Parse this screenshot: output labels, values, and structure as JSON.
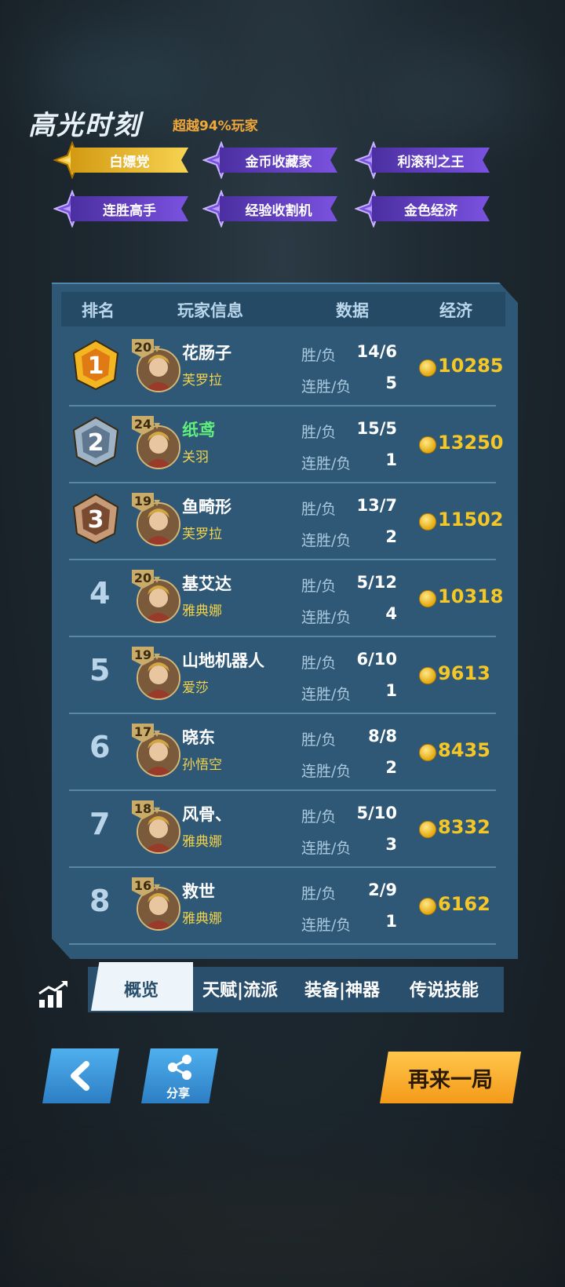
{
  "header": {
    "title": "高光时刻",
    "subtitle": "超越94%玩家"
  },
  "badges": [
    "白嫖党",
    "金币收藏家",
    "利滚利之王",
    "连胜高手",
    "经验收割机",
    "金色经济"
  ],
  "table": {
    "columns": [
      "排名",
      "玩家信息",
      "数据",
      "经济"
    ],
    "win_loss_label": "胜/负",
    "streak_label": "连胜/负",
    "rows": [
      {
        "rank": "1",
        "level": "20",
        "name": "花肠子",
        "hero": "芙罗拉",
        "win_loss": "14/6",
        "streak": "5",
        "gold": "10285"
      },
      {
        "rank": "2",
        "level": "24",
        "name": "纸鸢",
        "hero": "关羽",
        "win_loss": "15/5",
        "streak": "1",
        "gold": "13250"
      },
      {
        "rank": "3",
        "level": "19",
        "name": "鱼畸形",
        "hero": "芙罗拉",
        "win_loss": "13/7",
        "streak": "2",
        "gold": "11502"
      },
      {
        "rank": "4",
        "level": "20",
        "name": "基艾达",
        "hero": "雅典娜",
        "win_loss": "5/12",
        "streak": "4",
        "gold": "10318"
      },
      {
        "rank": "5",
        "level": "19",
        "name": "山地机器人",
        "hero": "爱莎",
        "win_loss": "6/10",
        "streak": "1",
        "gold": "9613"
      },
      {
        "rank": "6",
        "level": "17",
        "name": "晓东",
        "hero": "孙悟空",
        "win_loss": "8/8",
        "streak": "2",
        "gold": "8435"
      },
      {
        "rank": "7",
        "level": "18",
        "name": "风骨、",
        "hero": "雅典娜",
        "win_loss": "5/10",
        "streak": "3",
        "gold": "8332"
      },
      {
        "rank": "8",
        "level": "16",
        "name": "救世",
        "hero": "雅典娜",
        "win_loss": "2/9",
        "streak": "1",
        "gold": "6162"
      }
    ]
  },
  "tabs": [
    "概览",
    "天赋|流派",
    "装备|神器",
    "传说技能"
  ],
  "buttons": {
    "share": "分享",
    "again": "再来一局"
  },
  "colors": {
    "gold": "#f5c726",
    "highlight_name": "#5ff07c",
    "badge_purple": "#6a46d0",
    "badge_gold": "#f0c23a"
  }
}
